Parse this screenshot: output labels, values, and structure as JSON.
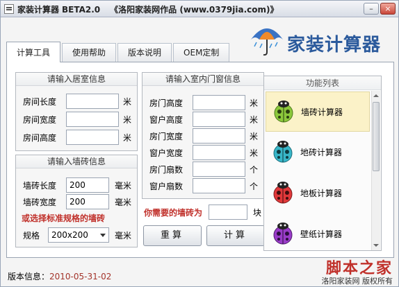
{
  "window": {
    "title": "家装计算器",
    "version": "BETA2.0",
    "tagline": "《洛阳家装网作品 (www.0379jia.com)》",
    "buttons": {
      "minimize": "–",
      "close": "×"
    }
  },
  "logo": {
    "text": "家装计算器"
  },
  "tabs": [
    {
      "label": "计算工具"
    },
    {
      "label": "使用帮助"
    },
    {
      "label": "版本说明"
    },
    {
      "label": "OEM定制"
    }
  ],
  "room": {
    "title": "请输入居室信息",
    "fields": [
      {
        "label": "房间长度",
        "value": "",
        "unit": "米"
      },
      {
        "label": "房间宽度",
        "value": "",
        "unit": "米"
      },
      {
        "label": "房间高度",
        "value": "",
        "unit": "米"
      }
    ]
  },
  "tile": {
    "title": "请输入墙砖信息",
    "fields": [
      {
        "label": "墙砖长度",
        "value": "200",
        "unit": "毫米"
      },
      {
        "label": "墙砖宽度",
        "value": "200",
        "unit": "毫米"
      }
    ],
    "standard_hint": "或选择标准规格的墙砖",
    "spec_label": "规格",
    "spec_value": "200x200",
    "spec_unit": "毫米"
  },
  "doors": {
    "title": "请输入室内门窗信息",
    "fields": [
      {
        "label": "房门高度",
        "value": "",
        "unit": "米"
      },
      {
        "label": "窗户高度",
        "value": "",
        "unit": "米"
      },
      {
        "label": "房门宽度",
        "value": "",
        "unit": "米"
      },
      {
        "label": "窗户宽度",
        "value": "",
        "unit": "米"
      },
      {
        "label": "房门扇数",
        "value": "",
        "unit": "个"
      },
      {
        "label": "窗户扇数",
        "value": "",
        "unit": "个"
      }
    ]
  },
  "result": {
    "label": "你需要的墙砖为",
    "value": "",
    "unit": "块"
  },
  "actions": {
    "reset": "重算",
    "calculate": "计算"
  },
  "functions": {
    "title": "功能列表",
    "items": [
      {
        "label": "墙砖计算器",
        "color": "#8cc83c",
        "selected": true
      },
      {
        "label": "地砖计算器",
        "color": "#38b6c8",
        "selected": false
      },
      {
        "label": "地板计算器",
        "color": "#e0383a",
        "selected": false
      },
      {
        "label": "壁纸计算器",
        "color": "#9a3cc8",
        "selected": false
      }
    ]
  },
  "footer": {
    "version_label": "版本信息：",
    "version_date": "2010-05-31-02"
  },
  "watermark": {
    "big": "脚本之家",
    "small": "洛阳家装网 版权所有"
  }
}
